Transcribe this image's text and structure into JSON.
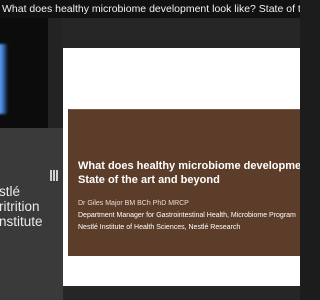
{
  "window": {
    "title": "What does healthy microbiome development look like? State of the art and beyo"
  },
  "sidebar": {
    "logo_lines": [
      "stlé",
      "ritrition",
      "nstitute"
    ]
  },
  "slide": {
    "title_line1": "What does healthy microbiome developme",
    "title_line2": "State of the art and beyond",
    "author": "Dr Giles Major BM BCh PhD MRCP",
    "role": "Department Manager for Gastrointestinal Health, Microbiome Program",
    "institute": "Nestlé Institute of Health Sciences, Nestlé Research"
  },
  "colors": {
    "banner": "#5c3d2a",
    "title_bar": "#111111",
    "background": "#1c1c1c"
  },
  "icons": {
    "player_control": "pause-icon"
  }
}
